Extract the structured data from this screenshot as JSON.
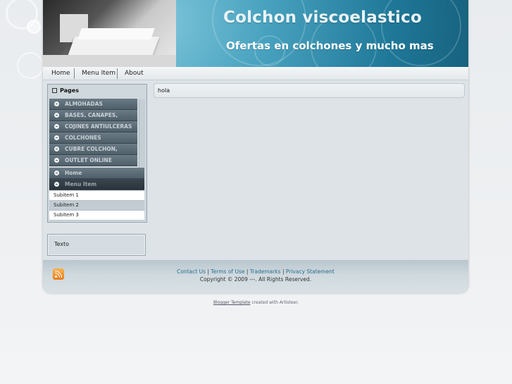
{
  "header": {
    "title": "Colchon viscoelastico",
    "slogan": "Ofertas en colchones y mucho mas"
  },
  "top_menu": [
    "Home",
    "Menu Item",
    "About"
  ],
  "sidebar": {
    "pages_title": "Pages",
    "items": [
      "ALMOHADAS",
      "BASES, CANAPES,",
      "COJINES ANTIULCERAS",
      "COLCHONES",
      "CUBRE COLCHON,",
      "OUTLET ONLINE",
      "Home",
      "Menu Item"
    ],
    "subitems": [
      "Subitem 1",
      "Subitem 2",
      "Subitem 3"
    ],
    "text_block": "Texto"
  },
  "post": {
    "content": "hola"
  },
  "footer": {
    "links": [
      "Contact Us",
      "Terms of Use",
      "Trademarks",
      "Privacy Statement"
    ],
    "copyright": "Copyright © 2009 ---. All Rights Reserved.",
    "credit_link": "Blogger Template",
    "credit_text": "created with Artisteer."
  },
  "colors": {
    "header_blue": "#1f7898",
    "menu_item_bg": "#5d6d78",
    "rss_orange": "#e97b1a",
    "footer_link": "#2a6f8f"
  },
  "icons": [
    "rss-feed-icon",
    "menu-bullet-icon",
    "pages-square-icon"
  ]
}
